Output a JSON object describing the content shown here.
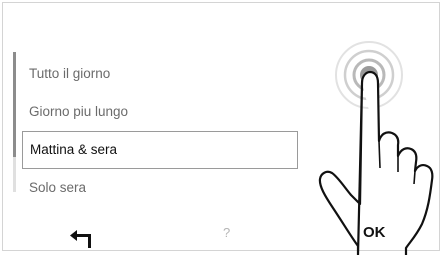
{
  "menu": {
    "items": [
      {
        "label": "Tutto il giorno",
        "selected": false
      },
      {
        "label": "Giorno piu lungo",
        "selected": false
      },
      {
        "label": "Mattina & sera",
        "selected": true
      },
      {
        "label": "Solo sera",
        "selected": false
      }
    ]
  },
  "footer": {
    "back_icon": "back-arrow-icon",
    "help_label": "?",
    "ok_label": "OK"
  },
  "overlay": {
    "gesture_icon": "tap-hand-icon"
  }
}
